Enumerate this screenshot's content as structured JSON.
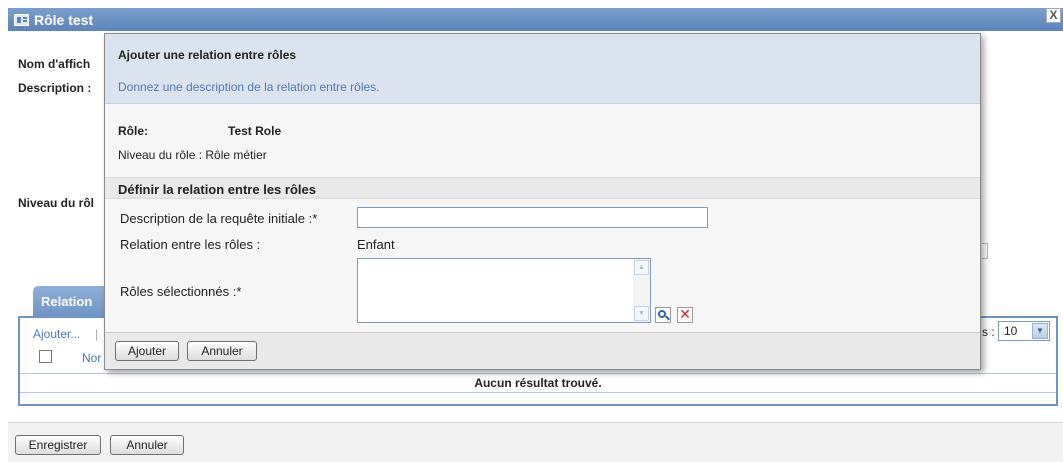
{
  "window": {
    "title": "Rôle test",
    "close_label": "X"
  },
  "background_form": {
    "display_name_label": "Nom d'affich",
    "description_label": "Description :",
    "role_level_label": "Niveau du rôl"
  },
  "relations_tab": {
    "tab_label": "Relation",
    "add_link": "Ajouter...",
    "link_separator": "|",
    "name_column": "Nor",
    "page_size_label": "s :",
    "page_size_value": "10",
    "no_results": "Aucun résultat trouvé."
  },
  "footer": {
    "save_label": "Enregistrer",
    "cancel_label": "Annuler"
  },
  "dialog": {
    "title": "Ajouter une relation entre rôles",
    "subtitle": "Donnez une description de la relation entre rôles.",
    "role_label": "Rôle:",
    "role_value": "Test Role",
    "role_level_text": "Niveau du rôle : Rôle métier",
    "section_title": "Définir la relation entre les rôles",
    "initial_request_label": "Description de la requête initiale :*",
    "initial_request_value": "",
    "relation_label": "Relation entre les rôles :",
    "relation_value": "Enfant",
    "selected_roles_label": "Rôles sélectionnés :*",
    "add_button": "Ajouter",
    "cancel_button": "Annuler"
  },
  "icons": {
    "window_icon": "role-icon",
    "search": "search-icon",
    "delete": "delete-icon"
  },
  "colors": {
    "title_bar": "#5c84b9",
    "dialog_header": "#dbe4ee",
    "link": "#4d78b0",
    "delete": "#d21f1f"
  }
}
